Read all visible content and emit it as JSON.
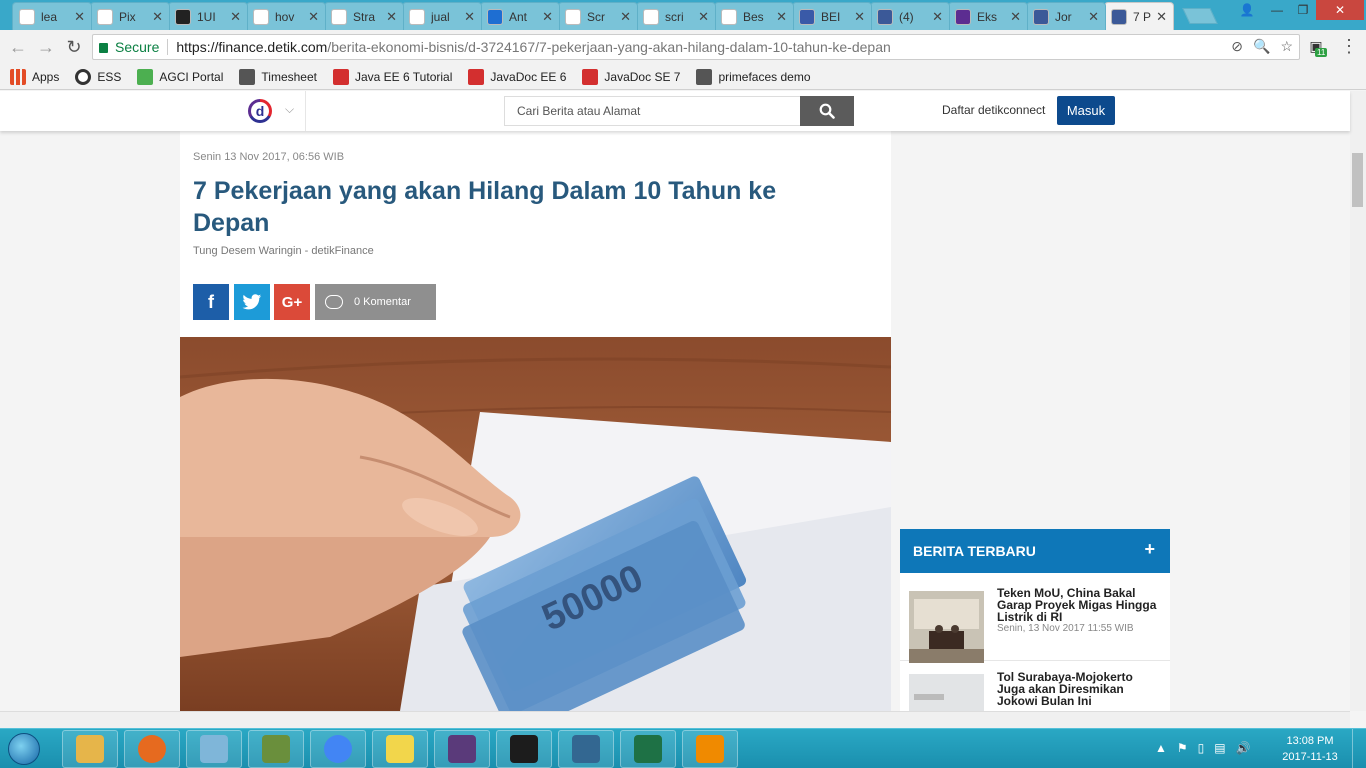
{
  "browser": {
    "tabs": [
      {
        "label": "lea",
        "favicon": "doc-icon",
        "color": "#ffffff"
      },
      {
        "label": "Pix",
        "favicon": "wikipedia-icon",
        "color": "#ffffff"
      },
      {
        "label": "1UI",
        "favicon": "info-icon",
        "color": "#222222"
      },
      {
        "label": "hov",
        "favicon": "google-icon",
        "color": "#ffffff"
      },
      {
        "label": "Stra",
        "favicon": "search-icon",
        "color": "#ffffff"
      },
      {
        "label": "jual",
        "favicon": "google-icon",
        "color": "#ffffff"
      },
      {
        "label": "Ant",
        "favicon": "a-logo-icon",
        "color": "#1e6ed2"
      },
      {
        "label": "Scr",
        "favicon": "scribd-icon",
        "color": "#ffffff"
      },
      {
        "label": "scri",
        "favicon": "google-icon",
        "color": "#ffffff"
      },
      {
        "label": "Bes",
        "favicon": "robot-icon",
        "color": "#ffffff"
      },
      {
        "label": "BEI",
        "favicon": "b-logo-icon",
        "color": "#3a5aa8"
      },
      {
        "label": "(4)",
        "favicon": "facebook-icon",
        "color": "#3b5998"
      },
      {
        "label": "Eks",
        "favicon": "detik-icon",
        "color": "#5c2d91"
      },
      {
        "label": "Jor",
        "favicon": "facebook-icon",
        "color": "#3b5998"
      },
      {
        "label": "7 P",
        "favicon": "facebook-icon",
        "color": "#3b5998"
      }
    ],
    "window": {
      "min": "—",
      "max": "❐",
      "close": "✕"
    },
    "nav": {
      "back": "←",
      "forward": "→",
      "reload": "↻"
    },
    "address": {
      "secure_label": "Secure",
      "url_host": "https://finance.detik.com",
      "url_path": "/berita-ekonomi-bisnis/d-3724167/7-pekerjaan-yang-akan-hilang-dalam-10-tahun-ke-depan"
    },
    "extension_badge": "11",
    "bookmarks": [
      {
        "label": "Apps",
        "icon": "apps-grid-icon",
        "color": "#e34c26"
      },
      {
        "label": "ESS",
        "icon": "circle-icon",
        "color": "#333333"
      },
      {
        "label": "AGCI Portal",
        "icon": "flower-icon",
        "color": "#4caf50"
      },
      {
        "label": "Timesheet",
        "icon": "calendar-icon",
        "color": "#555555"
      },
      {
        "label": "Java EE 6 Tutorial",
        "icon": "oracle-icon",
        "color": "#d32f2f"
      },
      {
        "label": "JavaDoc EE 6",
        "icon": "oracle-icon",
        "color": "#d32f2f"
      },
      {
        "label": "JavaDoc SE 7",
        "icon": "oracle-icon",
        "color": "#d32f2f"
      },
      {
        "label": "primefaces demo",
        "icon": "primefaces-icon",
        "color": "#555555"
      }
    ]
  },
  "site": {
    "logo_letter": "d",
    "search_placeholder": "Cari Berita atau Alamat",
    "register_label": "Daftar detikconnect",
    "login_label": "Masuk"
  },
  "article": {
    "date": "Senin 13 Nov 2017, 06:56 WIB",
    "title": "7 Pekerjaan yang akan Hilang Dalam 10 Tahun ke Depan",
    "author": "Tung Desem Waringin - detikFinance",
    "share": {
      "facebook": "f",
      "twitter": "t",
      "google": "G+"
    },
    "comments_label": "0 Komentar"
  },
  "sidebar": {
    "heading": "BERITA TERBARU",
    "expand": "+",
    "news": [
      {
        "title": "Teken MoU, China Bakal Garap Proyek Migas Hingga Listrik di RI",
        "time": "Senin, 13 Nov 2017 11:55 WIB"
      },
      {
        "title": "Tol Surabaya-Mojokerto Juga akan Diresmikan Jokowi Bulan Ini",
        "time": ""
      }
    ]
  },
  "taskbar": {
    "apps": [
      "explorer-icon",
      "firefox-icon",
      "notepad-icon",
      "chart-app-icon",
      "chrome-icon",
      "sticky-notes-icon",
      "java-ee-ide-icon",
      "terminal-icon",
      "postgres-icon",
      "excel-icon",
      "vlc-icon"
    ],
    "clock_time": "13:08 PM",
    "clock_date": "2017-11-13"
  }
}
